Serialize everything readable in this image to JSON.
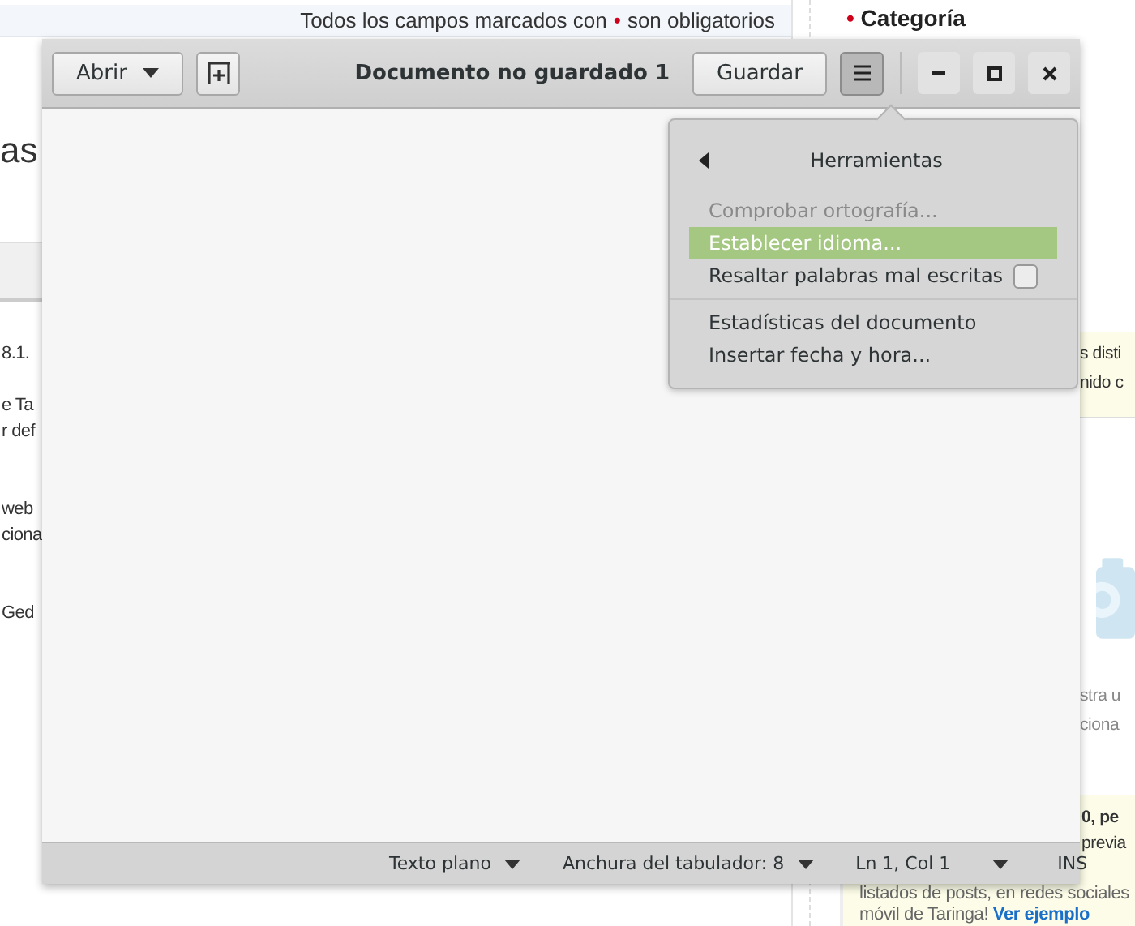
{
  "page": {
    "notice": {
      "text": "Todos los campos marcados con",
      "mark": "•",
      "text_after": "son obligatorios"
    },
    "left_fragments": [
      {
        "text": "as",
        "kind": "heading"
      },
      {
        "text": "8.1.",
        "kind": "line"
      },
      {
        "text": "e Ta",
        "kind": "line"
      },
      {
        "text": "r def",
        "kind": "line"
      },
      {
        "text": "web",
        "kind": "line"
      },
      {
        "text": "ciona",
        "kind": "line"
      },
      {
        "text": "Ged",
        "kind": "line"
      }
    ],
    "sidebar": {
      "heading_mark": "•",
      "heading": "Categoría",
      "box_top_lines": [
        "s disti",
        "nido c"
      ],
      "middle_lines": [
        "stra u",
        "ciona"
      ],
      "box_bottom_fragments": [
        "0, pe",
        "previa"
      ],
      "box_bottom_lines": [
        "listados de posts, en redes sociales",
        "móvil de Taringa!"
      ],
      "box_link": "Ver ejemplo"
    }
  },
  "window": {
    "title": "Documento no guardado 1",
    "open_button": "Abrir",
    "save_button": "Guardar",
    "menu_pressed": true,
    "popover": {
      "title": "Herramientas",
      "groups": [
        [
          {
            "label": "Comprobar ortografía...",
            "kind": "item",
            "disabled": true,
            "selected": false
          },
          {
            "label": "Establecer idioma...",
            "kind": "item",
            "disabled": false,
            "selected": true
          },
          {
            "label": "Resaltar palabras mal escritas",
            "kind": "check",
            "disabled": false,
            "selected": false,
            "checked": false
          }
        ],
        [
          {
            "label": "Estadísticas del documento",
            "kind": "item",
            "disabled": false,
            "selected": false
          },
          {
            "label": "Insertar fecha y hora...",
            "kind": "item",
            "disabled": false,
            "selected": false
          }
        ]
      ]
    },
    "status_bar": [
      {
        "label": "Texto plano",
        "kind": "dropdown"
      },
      {
        "label": "Anchura del tabulador: 8",
        "kind": "dropdown"
      },
      {
        "label": "Ln 1, Col 1",
        "kind": "text"
      },
      {
        "kind": "caret"
      },
      {
        "label": "INS",
        "kind": "text"
      }
    ]
  }
}
